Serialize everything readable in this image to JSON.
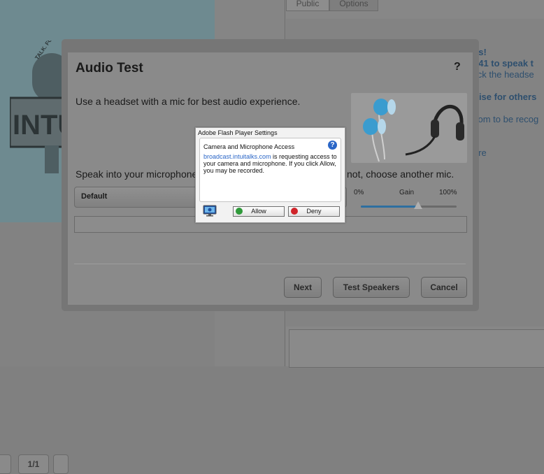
{
  "background": {
    "tabs": [
      {
        "label": "Public"
      },
      {
        "label": "Options"
      }
    ],
    "pager": {
      "page_label": "1/1"
    },
    "right_lines": [
      {
        "text": "es!"
      },
      {
        "text": "741 to speak t"
      },
      {
        "text": "lick the headse"
      },
      {
        "text": "oise for others"
      },
      {
        "text": "com to be recog"
      },
      {
        "text": "ere"
      }
    ],
    "logo": {
      "arc_text": "TALK. FOR",
      "block_text": "INTU"
    }
  },
  "dialog": {
    "title": "Audio Test",
    "help_label": "?",
    "instruction": "Use a headset with a mic for best audio experience.",
    "speak_prompt_start": "Speak into your microphone",
    "speak_prompt_end": "not, choose another mic.",
    "mic_select": {
      "value": "Default"
    },
    "gain": {
      "min_label": "0%",
      "label": "Gain",
      "max_label": "100%",
      "level": 0.6
    },
    "buttons": {
      "next": "Next",
      "test_speakers": "Test Speakers",
      "cancel": "Cancel"
    }
  },
  "flash_settings": {
    "title": "Adobe Flash Player Settings",
    "heading": "Camera and Microphone Access",
    "help_label": "?",
    "domain": "broadcast.intuitalks.com",
    "message": " is requesting access to your camera and microphone. If you click Allow, you may be recorded.",
    "allow_label": "Allow",
    "deny_label": "Deny"
  },
  "colors": {
    "link_blue": "#2a66c7",
    "allow_green": "#2f9a3a",
    "deny_red": "#d0242a",
    "gain_fill": "#2e6fa0"
  }
}
